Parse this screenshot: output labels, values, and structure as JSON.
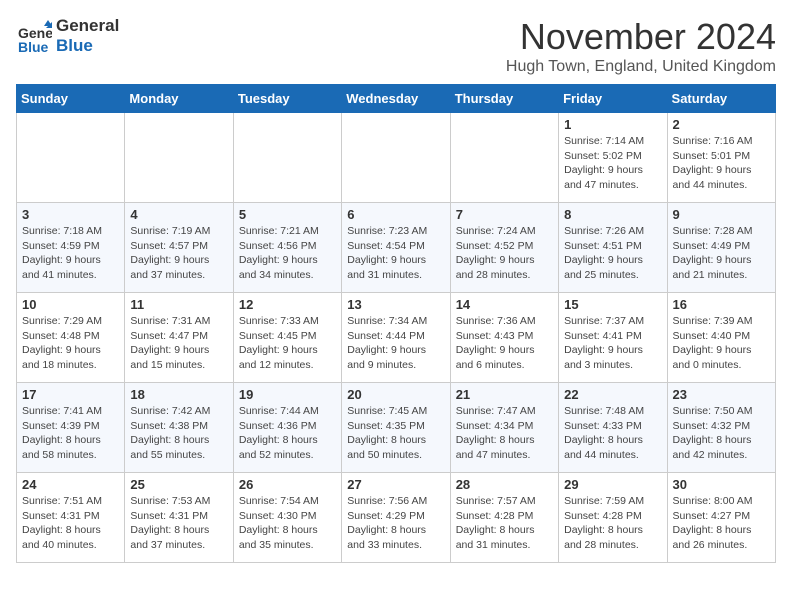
{
  "header": {
    "logo_line1": "General",
    "logo_line2": "Blue",
    "month": "November 2024",
    "location": "Hugh Town, England, United Kingdom"
  },
  "days_of_week": [
    "Sunday",
    "Monday",
    "Tuesday",
    "Wednesday",
    "Thursday",
    "Friday",
    "Saturday"
  ],
  "weeks": [
    [
      {
        "day": "",
        "info": ""
      },
      {
        "day": "",
        "info": ""
      },
      {
        "day": "",
        "info": ""
      },
      {
        "day": "",
        "info": ""
      },
      {
        "day": "",
        "info": ""
      },
      {
        "day": "1",
        "info": "Sunrise: 7:14 AM\nSunset: 5:02 PM\nDaylight: 9 hours and 47 minutes."
      },
      {
        "day": "2",
        "info": "Sunrise: 7:16 AM\nSunset: 5:01 PM\nDaylight: 9 hours and 44 minutes."
      }
    ],
    [
      {
        "day": "3",
        "info": "Sunrise: 7:18 AM\nSunset: 4:59 PM\nDaylight: 9 hours and 41 minutes."
      },
      {
        "day": "4",
        "info": "Sunrise: 7:19 AM\nSunset: 4:57 PM\nDaylight: 9 hours and 37 minutes."
      },
      {
        "day": "5",
        "info": "Sunrise: 7:21 AM\nSunset: 4:56 PM\nDaylight: 9 hours and 34 minutes."
      },
      {
        "day": "6",
        "info": "Sunrise: 7:23 AM\nSunset: 4:54 PM\nDaylight: 9 hours and 31 minutes."
      },
      {
        "day": "7",
        "info": "Sunrise: 7:24 AM\nSunset: 4:52 PM\nDaylight: 9 hours and 28 minutes."
      },
      {
        "day": "8",
        "info": "Sunrise: 7:26 AM\nSunset: 4:51 PM\nDaylight: 9 hours and 25 minutes."
      },
      {
        "day": "9",
        "info": "Sunrise: 7:28 AM\nSunset: 4:49 PM\nDaylight: 9 hours and 21 minutes."
      }
    ],
    [
      {
        "day": "10",
        "info": "Sunrise: 7:29 AM\nSunset: 4:48 PM\nDaylight: 9 hours and 18 minutes."
      },
      {
        "day": "11",
        "info": "Sunrise: 7:31 AM\nSunset: 4:47 PM\nDaylight: 9 hours and 15 minutes."
      },
      {
        "day": "12",
        "info": "Sunrise: 7:33 AM\nSunset: 4:45 PM\nDaylight: 9 hours and 12 minutes."
      },
      {
        "day": "13",
        "info": "Sunrise: 7:34 AM\nSunset: 4:44 PM\nDaylight: 9 hours and 9 minutes."
      },
      {
        "day": "14",
        "info": "Sunrise: 7:36 AM\nSunset: 4:43 PM\nDaylight: 9 hours and 6 minutes."
      },
      {
        "day": "15",
        "info": "Sunrise: 7:37 AM\nSunset: 4:41 PM\nDaylight: 9 hours and 3 minutes."
      },
      {
        "day": "16",
        "info": "Sunrise: 7:39 AM\nSunset: 4:40 PM\nDaylight: 9 hours and 0 minutes."
      }
    ],
    [
      {
        "day": "17",
        "info": "Sunrise: 7:41 AM\nSunset: 4:39 PM\nDaylight: 8 hours and 58 minutes."
      },
      {
        "day": "18",
        "info": "Sunrise: 7:42 AM\nSunset: 4:38 PM\nDaylight: 8 hours and 55 minutes."
      },
      {
        "day": "19",
        "info": "Sunrise: 7:44 AM\nSunset: 4:36 PM\nDaylight: 8 hours and 52 minutes."
      },
      {
        "day": "20",
        "info": "Sunrise: 7:45 AM\nSunset: 4:35 PM\nDaylight: 8 hours and 50 minutes."
      },
      {
        "day": "21",
        "info": "Sunrise: 7:47 AM\nSunset: 4:34 PM\nDaylight: 8 hours and 47 minutes."
      },
      {
        "day": "22",
        "info": "Sunrise: 7:48 AM\nSunset: 4:33 PM\nDaylight: 8 hours and 44 minutes."
      },
      {
        "day": "23",
        "info": "Sunrise: 7:50 AM\nSunset: 4:32 PM\nDaylight: 8 hours and 42 minutes."
      }
    ],
    [
      {
        "day": "24",
        "info": "Sunrise: 7:51 AM\nSunset: 4:31 PM\nDaylight: 8 hours and 40 minutes."
      },
      {
        "day": "25",
        "info": "Sunrise: 7:53 AM\nSunset: 4:31 PM\nDaylight: 8 hours and 37 minutes."
      },
      {
        "day": "26",
        "info": "Sunrise: 7:54 AM\nSunset: 4:30 PM\nDaylight: 8 hours and 35 minutes."
      },
      {
        "day": "27",
        "info": "Sunrise: 7:56 AM\nSunset: 4:29 PM\nDaylight: 8 hours and 33 minutes."
      },
      {
        "day": "28",
        "info": "Sunrise: 7:57 AM\nSunset: 4:28 PM\nDaylight: 8 hours and 31 minutes."
      },
      {
        "day": "29",
        "info": "Sunrise: 7:59 AM\nSunset: 4:28 PM\nDaylight: 8 hours and 28 minutes."
      },
      {
        "day": "30",
        "info": "Sunrise: 8:00 AM\nSunset: 4:27 PM\nDaylight: 8 hours and 26 minutes."
      }
    ]
  ]
}
